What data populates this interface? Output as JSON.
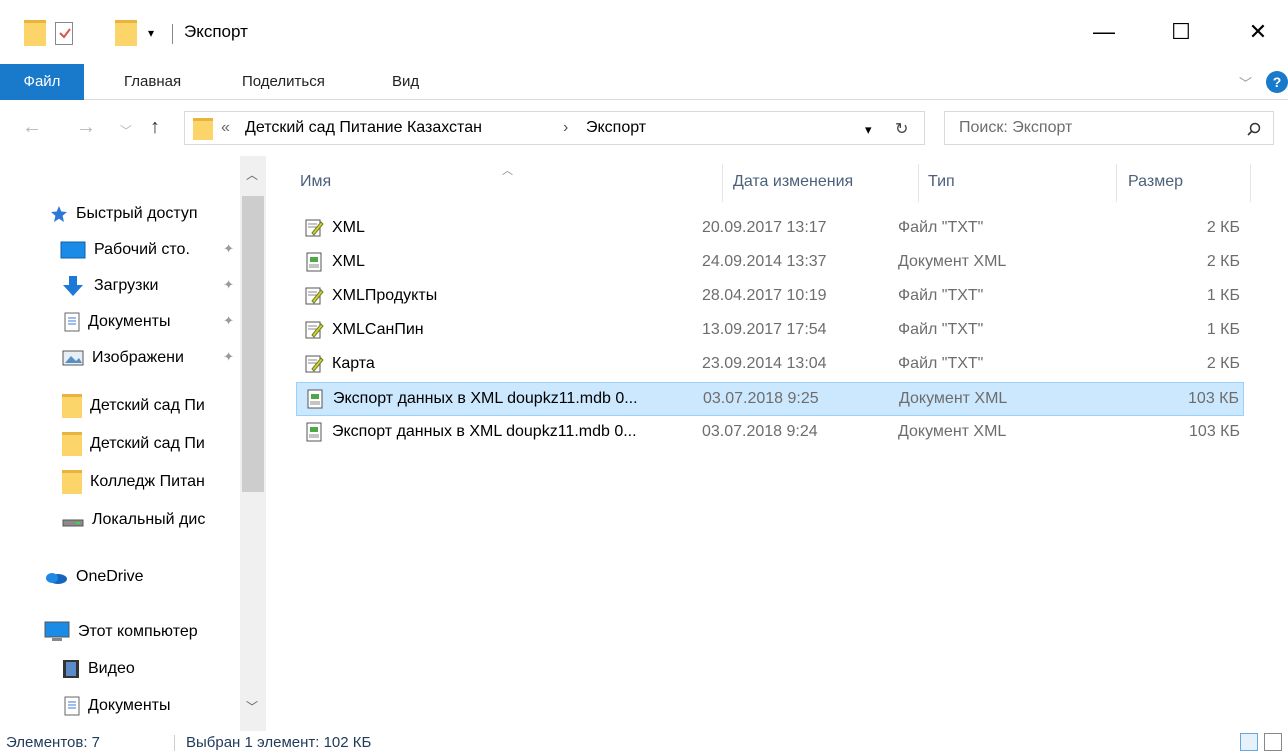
{
  "window": {
    "title": "Экспорт",
    "minimize": "—",
    "maximize": "☐",
    "close": "✕"
  },
  "ribbon": {
    "tabs": [
      "Файл",
      "Главная",
      "Поделиться",
      "Вид"
    ]
  },
  "address": {
    "overflow": "«",
    "crumbs": [
      "Детский сад Питание Казахстан",
      "Экспорт"
    ],
    "separator": "›",
    "search_placeholder": "Поиск: Экспорт"
  },
  "navpane": {
    "items": [
      {
        "label": "Быстрый доступ",
        "icon": "star-icon",
        "pinned": false
      },
      {
        "label": "Рабочий сто.",
        "icon": "desktop-icon",
        "pinned": true
      },
      {
        "label": "Загрузки",
        "icon": "download-icon",
        "pinned": true
      },
      {
        "label": "Документы",
        "icon": "documents-icon",
        "pinned": true
      },
      {
        "label": "Изображени",
        "icon": "pictures-icon",
        "pinned": true
      },
      {
        "label": "Детский сад Пи",
        "icon": "folder-icon",
        "pinned": false
      },
      {
        "label": "Детский сад Пи",
        "icon": "folder-icon",
        "pinned": false
      },
      {
        "label": "Колледж Питан",
        "icon": "folder-icon",
        "pinned": false
      },
      {
        "label": "Локальный дис",
        "icon": "drive-icon",
        "pinned": false
      },
      {
        "label": "OneDrive",
        "icon": "onedrive-icon",
        "pinned": false
      },
      {
        "label": "Этот компьютер",
        "icon": "computer-icon",
        "pinned": false
      },
      {
        "label": "Видео",
        "icon": "video-icon",
        "pinned": false
      },
      {
        "label": "Документы",
        "icon": "documents-icon",
        "pinned": false
      }
    ]
  },
  "columns": [
    "Имя",
    "Дата изменения",
    "Тип",
    "Размер"
  ],
  "files": [
    {
      "name": "XML",
      "date": "20.09.2017 13:17",
      "type": "Файл \"TXT\"",
      "size": "2 КБ",
      "icon": "txt-file-icon",
      "selected": false
    },
    {
      "name": "XML",
      "date": "24.09.2014 13:37",
      "type": "Документ XML",
      "size": "2 КБ",
      "icon": "xml-file-icon",
      "selected": false
    },
    {
      "name": "XMLПродукты",
      "date": "28.04.2017 10:19",
      "type": "Файл \"TXT\"",
      "size": "1 КБ",
      "icon": "txt-file-icon",
      "selected": false
    },
    {
      "name": "XMLСанПин",
      "date": "13.09.2017 17:54",
      "type": "Файл \"TXT\"",
      "size": "1 КБ",
      "icon": "txt-file-icon",
      "selected": false
    },
    {
      "name": "Карта",
      "date": "23.09.2014 13:04",
      "type": "Файл \"TXT\"",
      "size": "2 КБ",
      "icon": "txt-file-icon",
      "selected": false
    },
    {
      "name": "Экспорт данных в XML doupkz11.mdb 0...",
      "date": "03.07.2018 9:25",
      "type": "Документ XML",
      "size": "103 КБ",
      "icon": "xml-file-icon",
      "selected": true
    },
    {
      "name": "Экспорт данных в XML doupkz11.mdb 0...",
      "date": "03.07.2018 9:24",
      "type": "Документ XML",
      "size": "103 КБ",
      "icon": "xml-file-icon",
      "selected": false
    }
  ],
  "status": {
    "count": "Элементов: 7",
    "selection": "Выбран 1 элемент: 102 КБ"
  },
  "colors": {
    "accent": "#1979ca",
    "selection_bg": "#cce8ff",
    "selection_border": "#99d1ff",
    "folder": "#fcd56a"
  }
}
